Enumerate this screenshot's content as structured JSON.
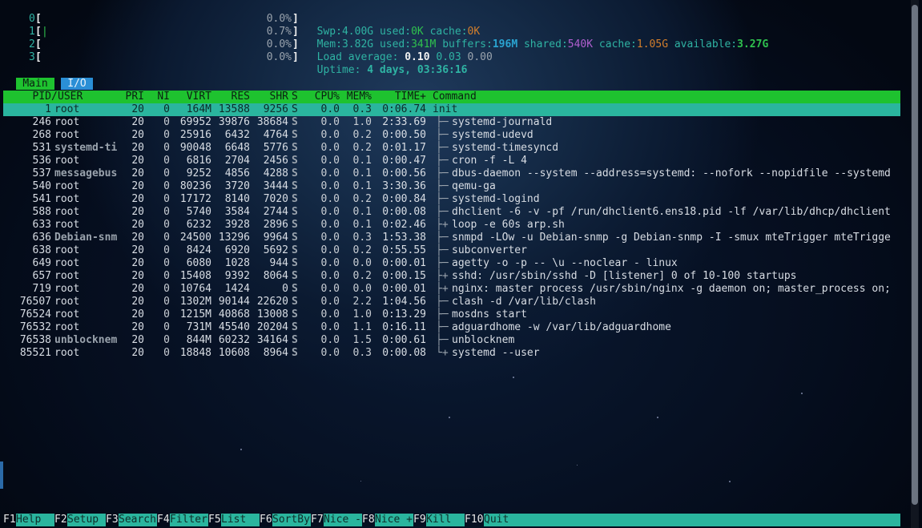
{
  "cpus": [
    {
      "id": "0",
      "pct": "0.0%"
    },
    {
      "id": "1",
      "pct": "0.7%"
    },
    {
      "id": "2",
      "pct": "0.0%"
    },
    {
      "id": "3",
      "pct": "0.0%"
    }
  ],
  "swap": {
    "label": "Swp:",
    "total": "4.00G",
    "used_label": "used:",
    "used": "0K",
    "cache_label": "cache:",
    "cache": "0K"
  },
  "mem": {
    "label": "Mem:",
    "total": "3.82G",
    "used_label": "used:",
    "used": "341M",
    "buffers_label": "buffers:",
    "buffers": "196M",
    "shared_label": "shared:",
    "shared": "540K",
    "cache_label": "cache:",
    "cache": "1.05G",
    "available_label": "available:",
    "available": "3.27G"
  },
  "load": {
    "label": "Load average:",
    "l1": "0.10",
    "l5": "0.03",
    "l15": "0.00"
  },
  "uptime": {
    "label": "Uptime:",
    "value": "4 days, 03:36:16"
  },
  "tabs": [
    {
      "label": "Main"
    },
    {
      "label": "I/O"
    }
  ],
  "columns": {
    "pid": "PID",
    "user": "USER",
    "pri": "PRI",
    "ni": "NI",
    "virt": "VIRT",
    "res": "RES",
    "shr": "SHR",
    "s": "S",
    "cpu": "CPU%",
    "mem": "MEM%",
    "time": "TIME+",
    "command": "Command"
  },
  "processes": [
    {
      "pid": "1",
      "user": "root",
      "pri": "20",
      "ni": "0",
      "virt": "164M",
      "res": "13588",
      "shr": "9256",
      "s": "S",
      "cpu": "0.0",
      "mem": "0.3",
      "time": "0:06.74",
      "tree": "",
      "command": "init"
    },
    {
      "pid": "246",
      "user": "root",
      "pri": "20",
      "ni": "0",
      "virt": "69952",
      "res": "39876",
      "shr": "38684",
      "s": "S",
      "cpu": "0.0",
      "mem": "1.0",
      "time": "2:33.69",
      "tree": "├─",
      "command": "systemd-journald"
    },
    {
      "pid": "268",
      "user": "root",
      "pri": "20",
      "ni": "0",
      "virt": "25916",
      "res": "6432",
      "shr": "4764",
      "s": "S",
      "cpu": "0.0",
      "mem": "0.2",
      "time": "0:00.50",
      "tree": "├─",
      "command": "systemd-udevd"
    },
    {
      "pid": "531",
      "user": "systemd-ti",
      "pri": "20",
      "ni": "0",
      "virt": "90048",
      "res": "6648",
      "shr": "5776",
      "s": "S",
      "cpu": "0.0",
      "mem": "0.2",
      "time": "0:01.17",
      "tree": "├─",
      "command": "systemd-timesyncd"
    },
    {
      "pid": "536",
      "user": "root",
      "pri": "20",
      "ni": "0",
      "virt": "6816",
      "res": "2704",
      "shr": "2456",
      "s": "S",
      "cpu": "0.0",
      "mem": "0.1",
      "time": "0:00.47",
      "tree": "├─",
      "command": "cron -f -L 4"
    },
    {
      "pid": "537",
      "user": "messagebus",
      "pri": "20",
      "ni": "0",
      "virt": "9252",
      "res": "4856",
      "shr": "4288",
      "s": "S",
      "cpu": "0.0",
      "mem": "0.1",
      "time": "0:00.56",
      "tree": "├─",
      "command": "dbus-daemon --system --address=systemd: --nofork --nopidfile --systemd"
    },
    {
      "pid": "540",
      "user": "root",
      "pri": "20",
      "ni": "0",
      "virt": "80236",
      "res": "3720",
      "shr": "3444",
      "s": "S",
      "cpu": "0.0",
      "mem": "0.1",
      "time": "3:30.36",
      "tree": "├─",
      "command": "qemu-ga"
    },
    {
      "pid": "541",
      "user": "root",
      "pri": "20",
      "ni": "0",
      "virt": "17172",
      "res": "8140",
      "shr": "7020",
      "s": "S",
      "cpu": "0.0",
      "mem": "0.2",
      "time": "0:00.84",
      "tree": "├─",
      "command": "systemd-logind"
    },
    {
      "pid": "588",
      "user": "root",
      "pri": "20",
      "ni": "0",
      "virt": "5740",
      "res": "3584",
      "shr": "2744",
      "s": "S",
      "cpu": "0.0",
      "mem": "0.1",
      "time": "0:00.08",
      "tree": "├─",
      "command": "dhclient -6 -v -pf /run/dhclient6.ens18.pid -lf /var/lib/dhcp/dhclient"
    },
    {
      "pid": "633",
      "user": "root",
      "pri": "20",
      "ni": "0",
      "virt": "6232",
      "res": "3928",
      "shr": "2896",
      "s": "S",
      "cpu": "0.0",
      "mem": "0.1",
      "time": "0:02.46",
      "tree": "├+",
      "command": "loop -e 60s arp.sh"
    },
    {
      "pid": "636",
      "user": "Debian-snm",
      "pri": "20",
      "ni": "0",
      "virt": "24500",
      "res": "13296",
      "shr": "9964",
      "s": "S",
      "cpu": "0.0",
      "mem": "0.3",
      "time": "1:53.38",
      "tree": "├─",
      "command": "snmpd -LOw -u Debian-snmp -g Debian-snmp -I -smux mteTrigger mteTrigge"
    },
    {
      "pid": "638",
      "user": "root",
      "pri": "20",
      "ni": "0",
      "virt": "8424",
      "res": "6920",
      "shr": "5692",
      "s": "S",
      "cpu": "0.0",
      "mem": "0.2",
      "time": "0:55.55",
      "tree": "├─",
      "command": "subconverter"
    },
    {
      "pid": "649",
      "user": "root",
      "pri": "20",
      "ni": "0",
      "virt": "6080",
      "res": "1028",
      "shr": "944",
      "s": "S",
      "cpu": "0.0",
      "mem": "0.0",
      "time": "0:00.01",
      "tree": "├─",
      "command": "agetty -o -p -- \\u --noclear - linux"
    },
    {
      "pid": "657",
      "user": "root",
      "pri": "20",
      "ni": "0",
      "virt": "15408",
      "res": "9392",
      "shr": "8064",
      "s": "S",
      "cpu": "0.0",
      "mem": "0.2",
      "time": "0:00.15",
      "tree": "├+",
      "command": "sshd: /usr/sbin/sshd -D [listener] 0 of 10-100 startups"
    },
    {
      "pid": "719",
      "user": "root",
      "pri": "20",
      "ni": "0",
      "virt": "10764",
      "res": "1424",
      "shr": "0",
      "s": "S",
      "cpu": "0.0",
      "mem": "0.0",
      "time": "0:00.01",
      "tree": "├+",
      "command": "nginx: master process /usr/sbin/nginx -g daemon on; master_process on;"
    },
    {
      "pid": "76507",
      "user": "root",
      "pri": "20",
      "ni": "0",
      "virt": "1302M",
      "res": "90144",
      "shr": "22620",
      "s": "S",
      "cpu": "0.0",
      "mem": "2.2",
      "time": "1:04.56",
      "tree": "├─",
      "command": "clash -d /var/lib/clash"
    },
    {
      "pid": "76524",
      "user": "root",
      "pri": "20",
      "ni": "0",
      "virt": "1215M",
      "res": "40868",
      "shr": "13008",
      "s": "S",
      "cpu": "0.0",
      "mem": "1.0",
      "time": "0:13.29",
      "tree": "├─",
      "command": "mosdns start"
    },
    {
      "pid": "76532",
      "user": "root",
      "pri": "20",
      "ni": "0",
      "virt": "731M",
      "res": "45540",
      "shr": "20204",
      "s": "S",
      "cpu": "0.0",
      "mem": "1.1",
      "time": "0:16.11",
      "tree": "├─",
      "command": "adguardhome -w /var/lib/adguardhome"
    },
    {
      "pid": "76538",
      "user": "unblocknem",
      "pri": "20",
      "ni": "0",
      "virt": "844M",
      "res": "60232",
      "shr": "34164",
      "s": "S",
      "cpu": "0.0",
      "mem": "1.5",
      "time": "0:00.61",
      "tree": "├─",
      "command": "unblocknem"
    },
    {
      "pid": "85521",
      "user": "root",
      "pri": "20",
      "ni": "0",
      "virt": "18848",
      "res": "10608",
      "shr": "8964",
      "s": "S",
      "cpu": "0.0",
      "mem": "0.3",
      "time": "0:00.08",
      "tree": "└+",
      "command": "systemd --user"
    }
  ],
  "footer": [
    {
      "key": "F1",
      "label": "Help"
    },
    {
      "key": "F2",
      "label": "Setup"
    },
    {
      "key": "F3",
      "label": "Search"
    },
    {
      "key": "F4",
      "label": "Filter"
    },
    {
      "key": "F5",
      "label": "List"
    },
    {
      "key": "F6",
      "label": "SortBy"
    },
    {
      "key": "F7",
      "label": "Nice -"
    },
    {
      "key": "F8",
      "label": "Nice +"
    },
    {
      "key": "F9",
      "label": "Kill"
    },
    {
      "key": "F10",
      "label": "Quit"
    }
  ]
}
